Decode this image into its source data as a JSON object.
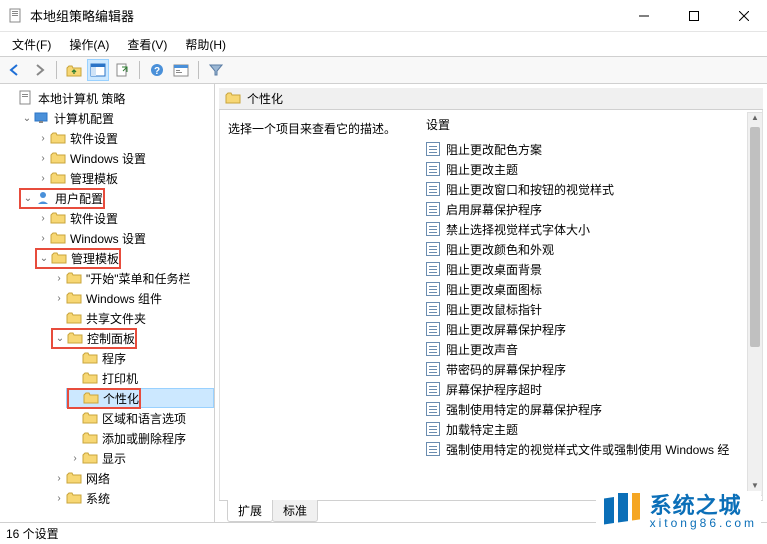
{
  "window": {
    "title": "本地组策略编辑器"
  },
  "menu": {
    "file": "文件(F)",
    "action": "操作(A)",
    "view": "查看(V)",
    "help": "帮助(H)"
  },
  "tree": {
    "root": "本地计算机 策略",
    "computer_config": "计算机配置",
    "cc_software": "软件设置",
    "cc_windows": "Windows 设置",
    "cc_admin": "管理模板",
    "user_config": "用户配置",
    "uc_software": "软件设置",
    "uc_windows": "Windows 设置",
    "uc_admin": "管理模板",
    "start_taskbar": "\"开始\"菜单和任务栏",
    "win_components": "Windows 组件",
    "shared_folders": "共享文件夹",
    "control_panel": "控制面板",
    "cp_programs": "程序",
    "cp_printers": "打印机",
    "cp_personalization": "个性化",
    "cp_region": "区域和语言选项",
    "cp_addremove": "添加或删除程序",
    "cp_display": "显示",
    "network": "网络",
    "system": "系统"
  },
  "content": {
    "header": "个性化",
    "desc_hint": "选择一个项目来查看它的描述。",
    "settings_col": "设置",
    "items": [
      "阻止更改配色方案",
      "阻止更改主题",
      "阻止更改窗口和按钮的视觉样式",
      "启用屏幕保护程序",
      "禁止选择视觉样式字体大小",
      "阻止更改颜色和外观",
      "阻止更改桌面背景",
      "阻止更改桌面图标",
      "阻止更改鼠标指针",
      "阻止更改屏幕保护程序",
      "阻止更改声音",
      "带密码的屏幕保护程序",
      "屏幕保护程序超时",
      "强制使用特定的屏幕保护程序",
      "加载特定主题",
      "强制使用特定的视觉样式文件或强制使用 Windows 经"
    ]
  },
  "tabs": {
    "extended": "扩展",
    "standard": "标准"
  },
  "status": {
    "count": "16 个设置"
  },
  "watermark": {
    "line1": "系统之城",
    "line2": "xitong86.com"
  }
}
